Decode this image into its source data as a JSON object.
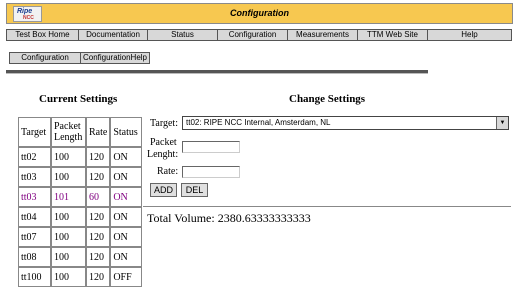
{
  "banner": {
    "title": "Configuration",
    "logo_main": "Ripe",
    "logo_sub": "NCC"
  },
  "nav": [
    "Test Box Home",
    "Documentation",
    "Status",
    "Configuration",
    "Measurements",
    "TTM Web Site",
    "Help"
  ],
  "subnav": [
    "Configuration",
    "ConfigurationHelp"
  ],
  "current": {
    "heading": "Current Settings",
    "headers": [
      "Target",
      "Packet Length",
      "Rate",
      "Status"
    ],
    "rows": [
      [
        "tt02",
        "100",
        "120",
        "ON"
      ],
      [
        "tt03",
        "100",
        "120",
        "ON"
      ],
      [
        "tt03",
        "101",
        "60",
        "ON"
      ],
      [
        "tt04",
        "100",
        "120",
        "ON"
      ],
      [
        "tt07",
        "100",
        "120",
        "ON"
      ],
      [
        "tt08",
        "100",
        "120",
        "ON"
      ],
      [
        "tt100",
        "100",
        "120",
        "OFF"
      ]
    ]
  },
  "change": {
    "heading": "Change Settings",
    "target_label": "Target:",
    "target_value": "tt02: RIPE NCC Internal, Amsterdam, NL",
    "packet_label_1": "Packet",
    "packet_label_2": "Lenght:",
    "rate_label": "Rate:",
    "add_label": "ADD",
    "del_label": "DEL"
  },
  "total": "Total Volume: 2380.63333333333"
}
